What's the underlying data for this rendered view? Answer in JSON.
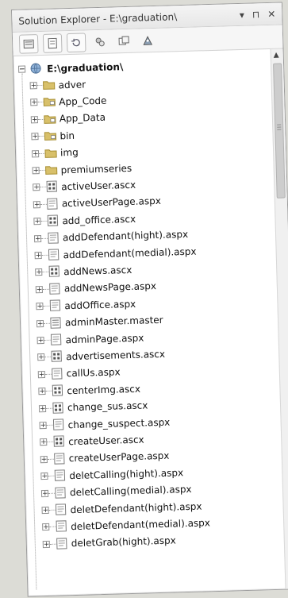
{
  "window": {
    "title": "Solution Explorer - E:\\graduation\\",
    "pin_icon": "pin-icon",
    "restore_icon": "restore-icon",
    "close_icon": "close-icon"
  },
  "toolbar": {
    "buttons": [
      {
        "name": "properties-icon"
      },
      {
        "name": "show-all-files-icon"
      },
      {
        "name": "refresh-icon"
      },
      {
        "name": "copy-website-icon"
      },
      {
        "name": "nest-related-files-icon"
      },
      {
        "name": "view-in-browser-icon"
      }
    ]
  },
  "tree": {
    "root": {
      "label": "E:\\graduation\\"
    },
    "items": [
      {
        "label": "adver",
        "kind": "folder"
      },
      {
        "label": "App_Code",
        "kind": "special-folder"
      },
      {
        "label": "App_Data",
        "kind": "special-folder"
      },
      {
        "label": "bin",
        "kind": "special-folder"
      },
      {
        "label": "img",
        "kind": "folder"
      },
      {
        "label": "premiumseries",
        "kind": "folder"
      },
      {
        "label": "activeUser.ascx",
        "kind": "ascx"
      },
      {
        "label": "activeUserPage.aspx",
        "kind": "aspx"
      },
      {
        "label": "add_office.ascx",
        "kind": "ascx"
      },
      {
        "label": "addDefendant(hight).aspx",
        "kind": "aspx"
      },
      {
        "label": "addDefendant(medial).aspx",
        "kind": "aspx"
      },
      {
        "label": "addNews.ascx",
        "kind": "ascx"
      },
      {
        "label": "addNewsPage.aspx",
        "kind": "aspx"
      },
      {
        "label": "addOffice.aspx",
        "kind": "aspx"
      },
      {
        "label": "adminMaster.master",
        "kind": "master"
      },
      {
        "label": "adminPage.aspx",
        "kind": "aspx"
      },
      {
        "label": "advertisements.ascx",
        "kind": "ascx"
      },
      {
        "label": "callUs.aspx",
        "kind": "aspx"
      },
      {
        "label": "centerImg.ascx",
        "kind": "ascx"
      },
      {
        "label": "change_sus.ascx",
        "kind": "ascx"
      },
      {
        "label": "change_suspect.aspx",
        "kind": "aspx"
      },
      {
        "label": "createUser.ascx",
        "kind": "ascx"
      },
      {
        "label": "createUserPage.aspx",
        "kind": "aspx"
      },
      {
        "label": "deletCalling(hight).aspx",
        "kind": "aspx"
      },
      {
        "label": "deletCalling(medial).aspx",
        "kind": "aspx"
      },
      {
        "label": "deletDefendant(hight).aspx",
        "kind": "aspx"
      },
      {
        "label": "deletDefendant(medial).aspx",
        "kind": "aspx"
      },
      {
        "label": "deletGrab(hight).aspx",
        "kind": "aspx"
      }
    ]
  },
  "colors": {
    "folder": "#d8c06a",
    "folder_edge": "#a88f33",
    "file_border": "#7a7a7a"
  }
}
